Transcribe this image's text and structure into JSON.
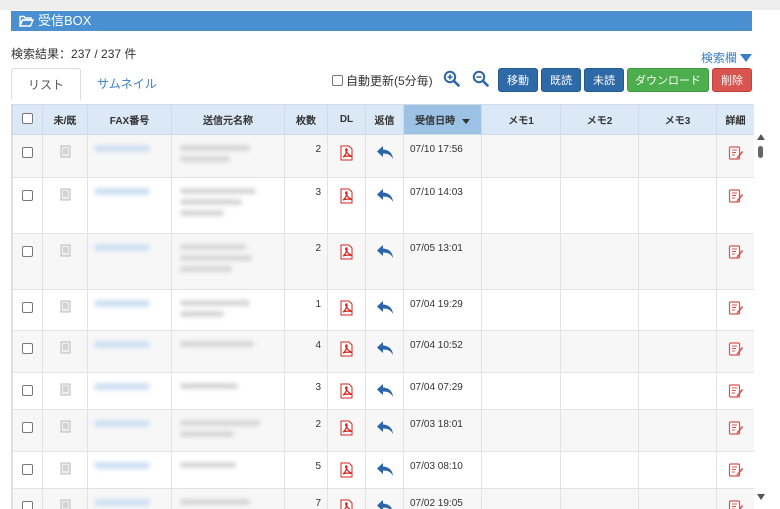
{
  "header": {
    "title": "受信BOX",
    "icon": "folder-open-icon"
  },
  "result": {
    "label": "検索結果：",
    "count": "237 / 237 件"
  },
  "search_toggle": {
    "label": "検索欄",
    "icon": "caret-down-icon"
  },
  "tabs": [
    {
      "label": "リスト",
      "active": true
    },
    {
      "label": "サムネイル",
      "active": false
    }
  ],
  "toolbar": {
    "auto_refresh_label": "自動更新(5分毎)",
    "zoom_in_icon": "zoom-in-icon",
    "zoom_out_icon": "zoom-out-icon",
    "move_label": "移動",
    "read_label": "既読",
    "unread_label": "未読",
    "download_label": "ダウンロード",
    "delete_label": "削除"
  },
  "columns": {
    "read_status": "未/既",
    "fax": "FAX番号",
    "sender": "送信元名称",
    "pages": "枚数",
    "dl": "DL",
    "reply": "返信",
    "received": "受信日時",
    "memo1": "メモ1",
    "memo2": "メモ2",
    "memo3": "メモ3",
    "detail": "詳細"
  },
  "rows": [
    {
      "pages": "2",
      "received": "07/10 17:56"
    },
    {
      "pages": "3",
      "received": "07/10 14:03"
    },
    {
      "pages": "2",
      "received": "07/05 13:01"
    },
    {
      "pages": "1",
      "received": "07/04 19:29"
    },
    {
      "pages": "4",
      "received": "07/04 10:52"
    },
    {
      "pages": "3",
      "received": "07/04 07:29"
    },
    {
      "pages": "2",
      "received": "07/03 18:01"
    },
    {
      "pages": "5",
      "received": "07/03 08:10"
    },
    {
      "pages": "7",
      "received": "07/02 19:05"
    }
  ],
  "colors": {
    "header": "#4a8fcf",
    "accent": "#3a7fc4",
    "green": "#4cae4c",
    "red": "#d9534f",
    "pdf": "#d9261c",
    "reply": "#2b64a8"
  }
}
